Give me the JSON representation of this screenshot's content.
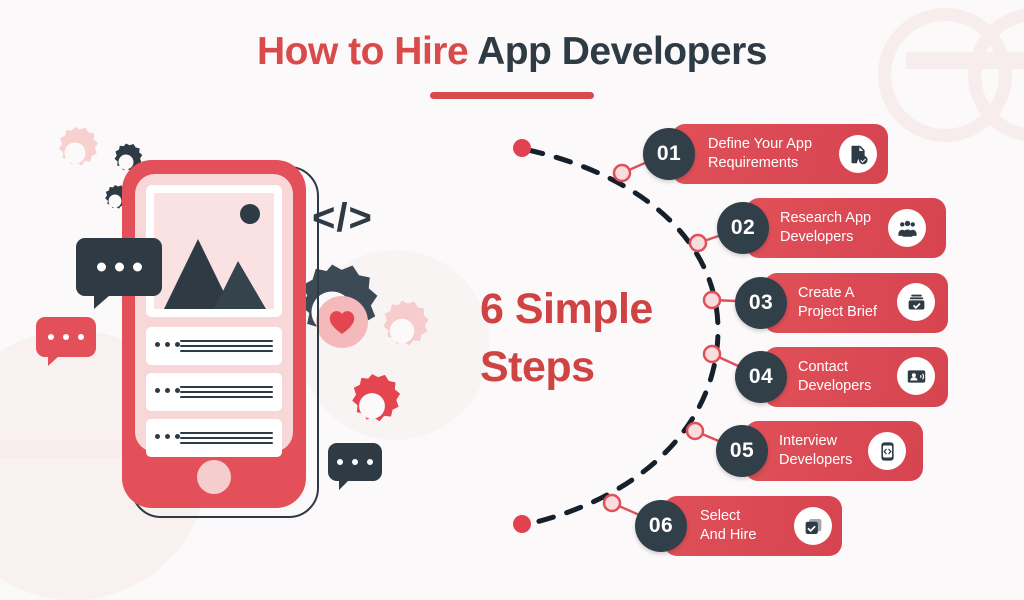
{
  "theme": {
    "background": "#fbf9f9",
    "red": "#d94a4a",
    "pill_red": "#e05058",
    "dark_navy": "#2e3b45",
    "circle_navy": "#313f48",
    "pink": "#f7d7d7",
    "watermark": "#f7eded"
  },
  "title": {
    "part_red": "How to Hire",
    "part_dark": "App Developers"
  },
  "headline": {
    "line1": "6 Simple",
    "line2": "Steps"
  },
  "illustration": {
    "code_symbol": "</>",
    "heart_icon": "heart-icon",
    "phone_icon": "smartphone-illustration",
    "gear_icon": "gear-icon",
    "chat_icon": "chat-bubble-icon"
  },
  "steps": [
    {
      "number": "01",
      "label": "Define Your App\nRequirements",
      "icon": "document-check-icon"
    },
    {
      "number": "02",
      "label": "Research App\nDevelopers",
      "icon": "people-group-icon"
    },
    {
      "number": "03",
      "label": "Create A\nProject Brief",
      "icon": "briefcase-check-icon"
    },
    {
      "number": "04",
      "label": "Contact\nDevelopers",
      "icon": "contact-card-icon"
    },
    {
      "number": "05",
      "label": "Interview\nDevelopers",
      "icon": "phone-code-icon"
    },
    {
      "number": "06",
      "label": "Select\nAnd Hire",
      "icon": "checkbox-stack-icon"
    }
  ]
}
